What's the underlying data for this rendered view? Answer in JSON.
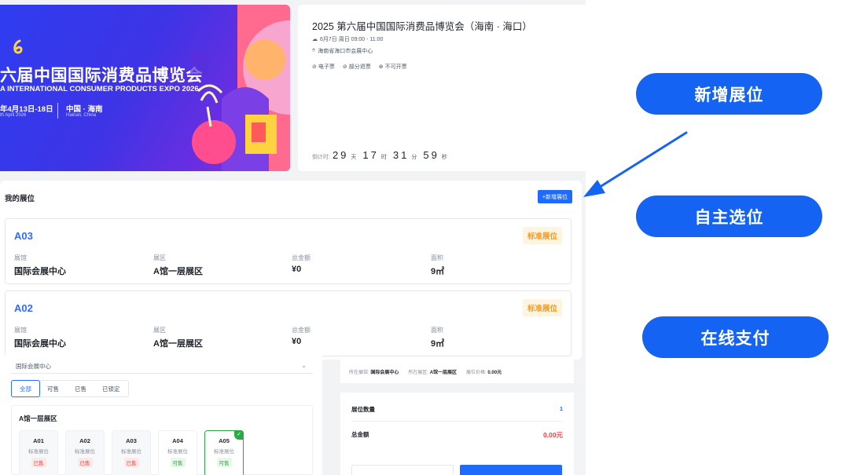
{
  "banner": {
    "edition_glyph": "6",
    "title": "六届中国国际消费品博览会",
    "subtitle": "A INTERNATIONAL CONSUMER PRODUCTS EXPO 2026",
    "date": "年4月13日-18日",
    "date_en": "th April 2026",
    "location": "中国 · 海南",
    "location_en": "Hainan, China"
  },
  "event": {
    "title": "2025 第六届中国国际消费品博览会（海南 · 海口）",
    "time": "6月7日 周日 09:00 - 11:00",
    "address": "海南省海口市会展中心",
    "tags": [
      "电子票",
      "部分退票",
      "不可开票"
    ],
    "countdown": {
      "label": "倒计时:",
      "days": "29",
      "days_unit": "天",
      "hours": "17",
      "hours_unit": "时",
      "minutes": "31",
      "minutes_unit": "分",
      "seconds": "59",
      "seconds_unit": "秒"
    }
  },
  "my_booths": {
    "title": "我的展位",
    "add_button": "+新增展位",
    "cards": [
      {
        "code": "A03",
        "badge": "标准展位",
        "venue_label": "展馆",
        "venue": "国际会展中心",
        "zone_label": "展区",
        "zone": "A馆一层展区",
        "amount_label": "总金额",
        "amount": "¥0",
        "area_label": "面积",
        "area": "9㎡"
      },
      {
        "code": "A02",
        "badge": "标准展位",
        "venue_label": "展馆",
        "venue": "国际会展中心",
        "zone_label": "展区",
        "zone": "A馆一层展区",
        "amount_label": "总金额",
        "amount": "¥0",
        "area_label": "面积",
        "area": "9㎡"
      }
    ]
  },
  "selection": {
    "venue_select": "国际会展中心",
    "filters": [
      "全部",
      "可售",
      "已售",
      "已锁定"
    ],
    "hall_title": "A馆一层展区",
    "slots": [
      {
        "code": "A01",
        "type": "标准展位",
        "status": "已售",
        "state": "sold"
      },
      {
        "code": "A02",
        "type": "标准展位",
        "status": "已售",
        "state": "sold"
      },
      {
        "code": "A03",
        "type": "标准展位",
        "status": "已售",
        "state": "sold"
      },
      {
        "code": "A04",
        "type": "标准展位",
        "status": "可售",
        "state": "available"
      },
      {
        "code": "A05",
        "type": "标准展位",
        "status": "可售",
        "state": "selected"
      }
    ]
  },
  "summary": {
    "venue_label": "所在展馆:",
    "venue": "国际会展中心",
    "zone_label": "所在展区:",
    "zone": "A馆一层展区",
    "price_label": "展位价格:",
    "price": "0.00元",
    "count_label": "展位数量",
    "count": "1",
    "total_label": "总金额",
    "total": "0.00元"
  },
  "callouts": {
    "add_booth": "新增展位",
    "self_select": "自主选位",
    "online_pay": "在线支付"
  },
  "colors": {
    "accent": "#1f6bff",
    "callout": "#1463f3",
    "badge_text": "#f29b1d",
    "sold": "#f53f3f",
    "available": "#2ea845"
  }
}
